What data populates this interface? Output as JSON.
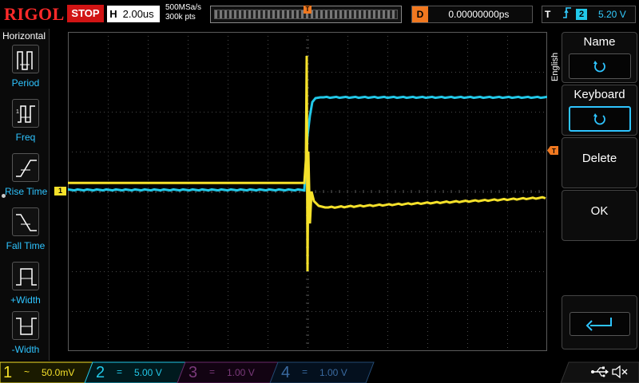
{
  "brand": "RIGOL",
  "run_state": "STOP",
  "horizontal": {
    "tag": "H",
    "scale": "2.00us",
    "sample_rate": "500MSa/s",
    "memory_depth": "300k pts"
  },
  "delay": {
    "tag": "D",
    "value": "0.00000000ps"
  },
  "trigger": {
    "tag": "T",
    "source": "2",
    "level": "5.20 V"
  },
  "left_menu": {
    "title": "Horizontal",
    "items": [
      {
        "label": "Period",
        "icon": "period-icon"
      },
      {
        "label": "Freq",
        "icon": "frequency-icon"
      },
      {
        "label": "Rise Time",
        "icon": "rise-time-icon"
      },
      {
        "label": "Fall Time",
        "icon": "fall-time-icon"
      },
      {
        "label": "+Width",
        "icon": "positive-width-icon"
      },
      {
        "label": "-Width",
        "icon": "negative-width-icon"
      }
    ]
  },
  "right_menu": {
    "language": "English",
    "name_label": "Name",
    "keyboard_label": "Keyboard",
    "delete_label": "Delete",
    "ok_label": "OK",
    "enter_icon": "enter-icon"
  },
  "channels": [
    {
      "num": "1",
      "scale": "50.0mV",
      "color": "#f5e12a",
      "active": true
    },
    {
      "num": "2",
      "scale": "5.00 V",
      "color": "#22c8e8",
      "active": true
    },
    {
      "num": "3",
      "scale": "1.00 V",
      "color": "#d23cd2",
      "active": false
    },
    {
      "num": "4",
      "scale": "1.00 V",
      "color": "#2e7bd8",
      "active": false
    }
  ],
  "ch1_marker": "1",
  "colors": {
    "ch1": "#f5e12a",
    "ch2": "#22c8e8",
    "accent": "#f07820",
    "menu_highlight": "#2ec4ff",
    "stop": "#d11414"
  },
  "status_icons": [
    "usb-icon",
    "speaker-muted-icon"
  ]
}
